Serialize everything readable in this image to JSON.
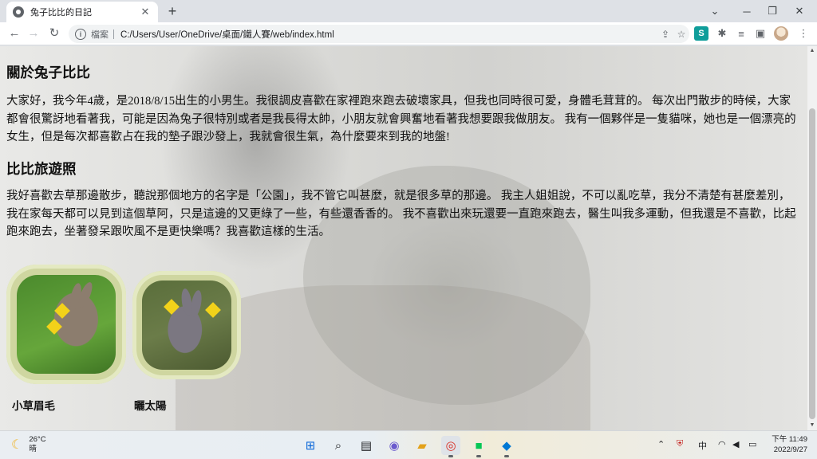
{
  "browser": {
    "tab_title": "兔子比比的日記",
    "tab_close": "✕",
    "new_tab": "+",
    "address_label": "檔案",
    "url": "C:/Users/User/OneDrive/桌面/鐵人賽/web/index.html",
    "ext_s_label": "S",
    "info_label": "i"
  },
  "page": {
    "about_heading": "關於兔子比比",
    "about_text": "大家好，我今年4歲，是2018/8/15出生的小男生。我很調皮喜歡在家裡跑來跑去破壞家具，但我也同時很可愛，身體毛茸茸的。 每次出門散步的時候，大家都會很驚訝地看著我，可能是因為兔子很特別或者是我長得太帥，小朋友就會興奮地看著我想要跟我做朋友。 我有一個夥伴是一隻貓咪，她也是一個漂亮的女生，但是每次都喜歡占在我的墊子跟沙發上，我就會很生氣，為什麼要來到我的地盤!",
    "photos_heading": "比比旅遊照",
    "photos_text": "我好喜歡去草那邊散步，聽說那個地方的名字是「公園」，我不管它叫甚麼，就是很多草的那邊。 我主人姐姐說，不可以亂吃草，我分不清楚有甚麼差別，我在家每天都可以見到這個草阿，只是這邊的又更綠了一些，有些還香香的。 我不喜歡出來玩還要一直跑來跑去，醫生叫我多運動，但我還是不喜歡，比起跑來跑去，坐著發呆跟吹風不是更快樂嗎？我喜歡這樣的生活。",
    "photos": [
      {
        "caption": "小草眉毛"
      },
      {
        "caption": "曬太陽"
      }
    ]
  },
  "taskbar": {
    "temperature": "26°C",
    "weather": "晴",
    "ime": "中",
    "time": "下午 11:49",
    "date": "2022/9/27"
  },
  "colors": {
    "frame": "#cfd6a0",
    "tab_bg": "#dee1e6",
    "accent_teal": "#0f9d9a"
  }
}
